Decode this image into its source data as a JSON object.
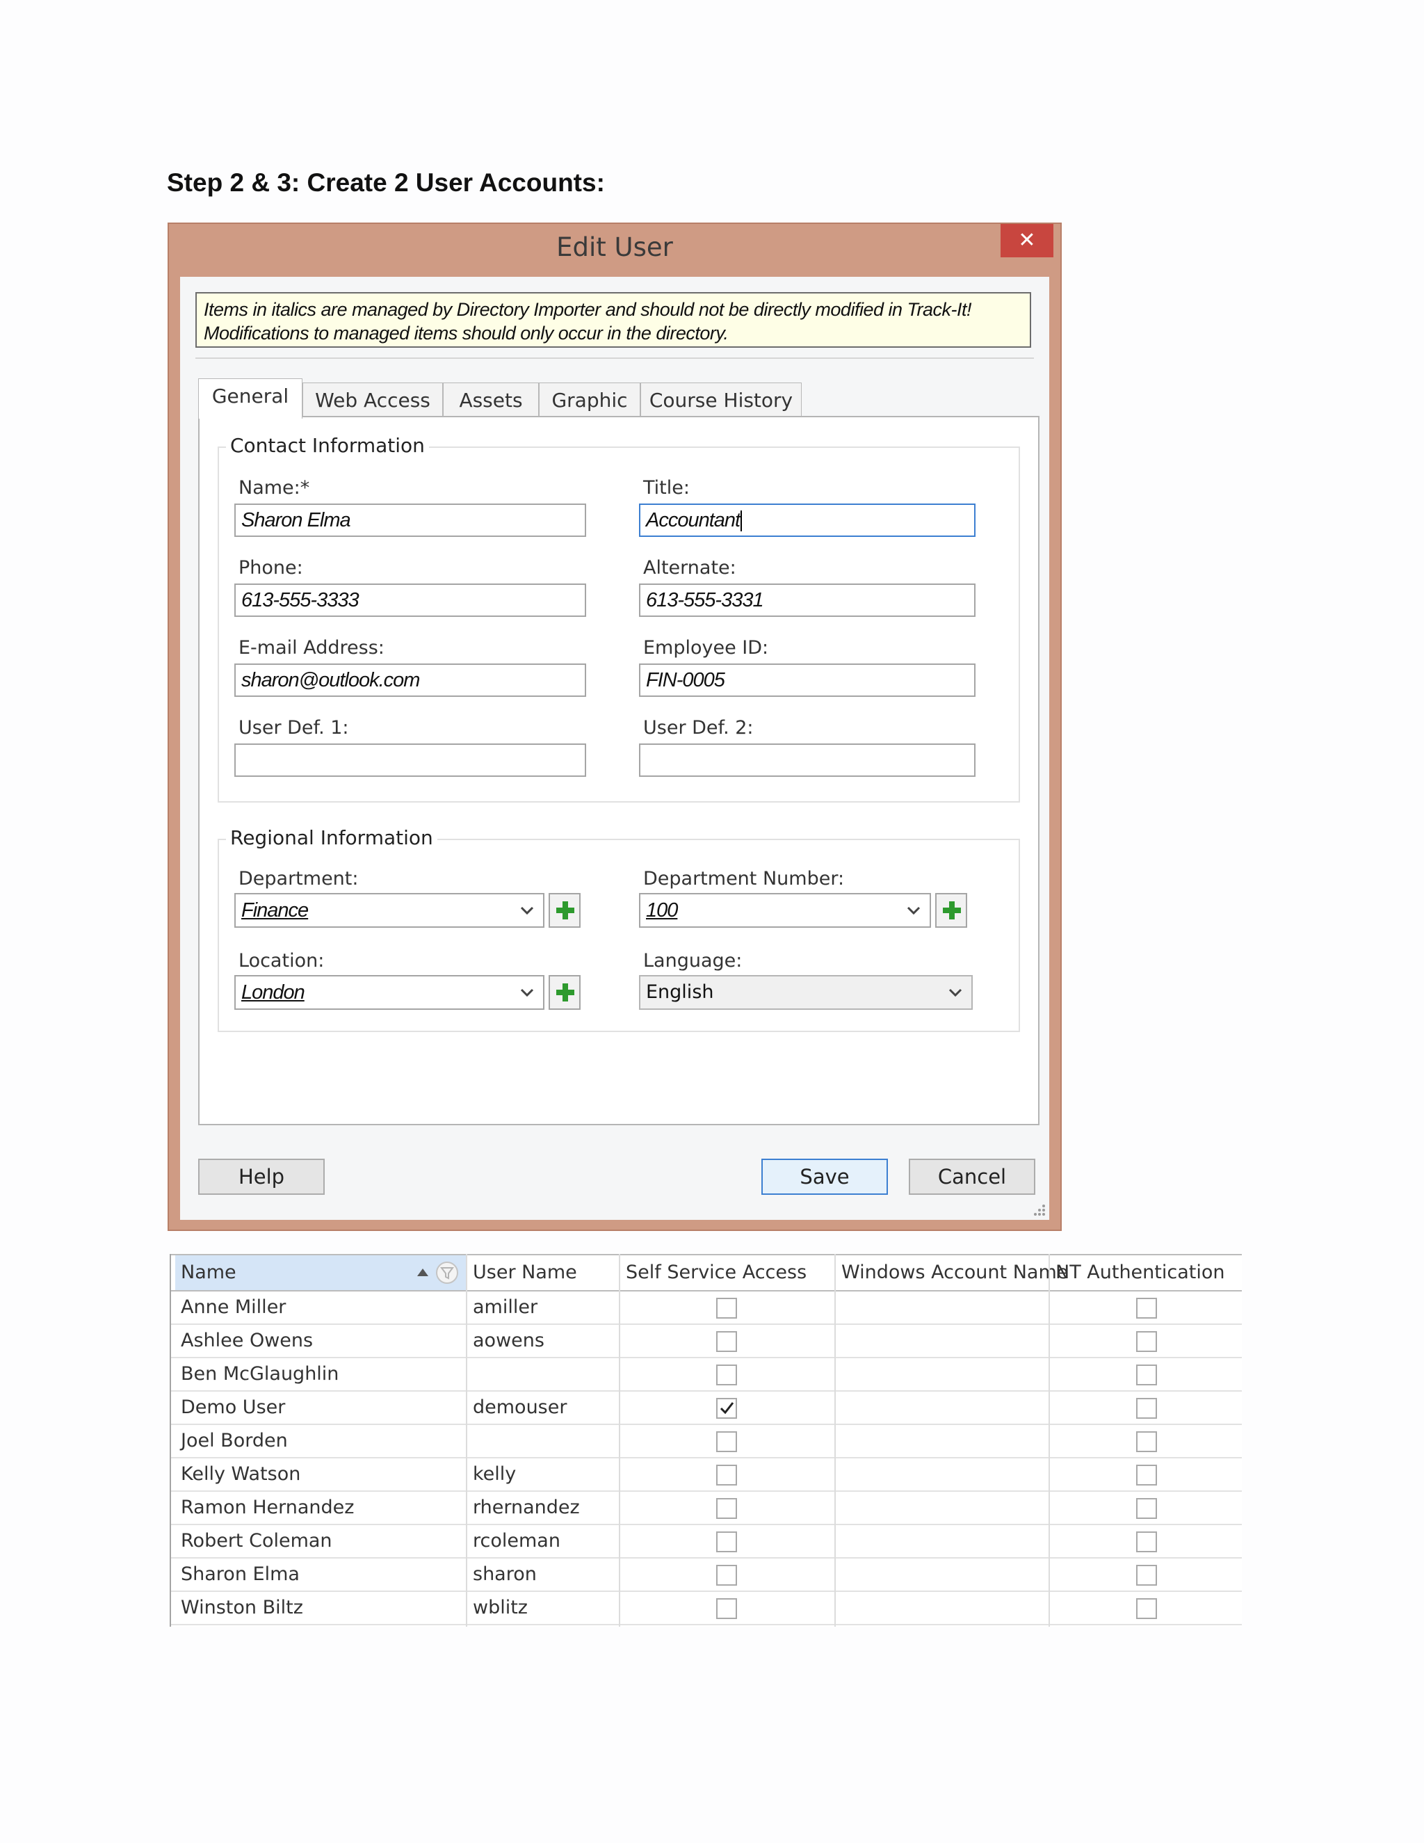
{
  "heading": "Step 2 & 3: Create 2 User Accounts:",
  "dialog": {
    "title": "Edit User",
    "close": "✕",
    "notice": [
      "Items in italics are managed by Directory Importer and should not be directly modified in Track-It!",
      "Modifications to managed items should only occur in the directory."
    ],
    "tabs": [
      "General",
      "Web Access",
      "Assets",
      "Graphic",
      "Course History"
    ],
    "contact": {
      "title": "Contact Information",
      "name_label": "Name:*",
      "name_value": "Sharon Elma",
      "title_label": "Title:",
      "title_value": "Accountant",
      "phone_label": "Phone:",
      "phone_value": "613-555-3333",
      "alternate_label": "Alternate:",
      "alternate_value": "613-555-3331",
      "email_label": "E-mail Address:",
      "email_value": "sharon@outlook.com",
      "employee_label": "Employee ID:",
      "employee_value": "FIN-0005",
      "userdef1_label": "User Def. 1:",
      "userdef1_value": "",
      "userdef2_label": "User Def. 2:",
      "userdef2_value": ""
    },
    "regional": {
      "title": "Regional Information",
      "department_label": "Department:",
      "department_value": "Finance",
      "deptnum_label": "Department Number:",
      "deptnum_value": "100",
      "location_label": "Location:",
      "location_value": "London",
      "language_label": "Language:",
      "language_value": "English"
    },
    "buttons": {
      "help": "Help",
      "save": "Save",
      "cancel": "Cancel"
    }
  },
  "grid": {
    "columns": [
      "Name",
      "User Name",
      "Self Service Access",
      "Windows Account Name",
      "NT Authentication"
    ],
    "rows": [
      {
        "name": "Anne Miller",
        "username": "amiller",
        "self_service": false,
        "windows": "",
        "nt": false
      },
      {
        "name": "Ashlee Owens",
        "username": "aowens",
        "self_service": false,
        "windows": "",
        "nt": false
      },
      {
        "name": "Ben McGlaughlin",
        "username": "",
        "self_service": false,
        "windows": "",
        "nt": false
      },
      {
        "name": "Demo User",
        "username": "demouser",
        "self_service": true,
        "windows": "",
        "nt": false
      },
      {
        "name": "Joel Borden",
        "username": "",
        "self_service": false,
        "windows": "",
        "nt": false
      },
      {
        "name": "Kelly Watson",
        "username": "kelly",
        "self_service": false,
        "windows": "",
        "nt": false
      },
      {
        "name": "Ramon Hernandez",
        "username": "rhernandez",
        "self_service": false,
        "windows": "",
        "nt": false
      },
      {
        "name": "Robert Coleman",
        "username": "rcoleman",
        "self_service": false,
        "windows": "",
        "nt": false
      },
      {
        "name": "Sharon Elma",
        "username": "sharon",
        "self_service": false,
        "windows": "",
        "nt": false
      },
      {
        "name": "Winston Biltz",
        "username": "wblitz",
        "self_service": false,
        "windows": "",
        "nt": false
      }
    ]
  },
  "colors": {
    "dialog_frame": "#cf9b84",
    "close": "#c8463f",
    "notice_bg": "#fefee6",
    "sorted_header": "#d5e5f7",
    "plus": "#2e9a2e"
  }
}
